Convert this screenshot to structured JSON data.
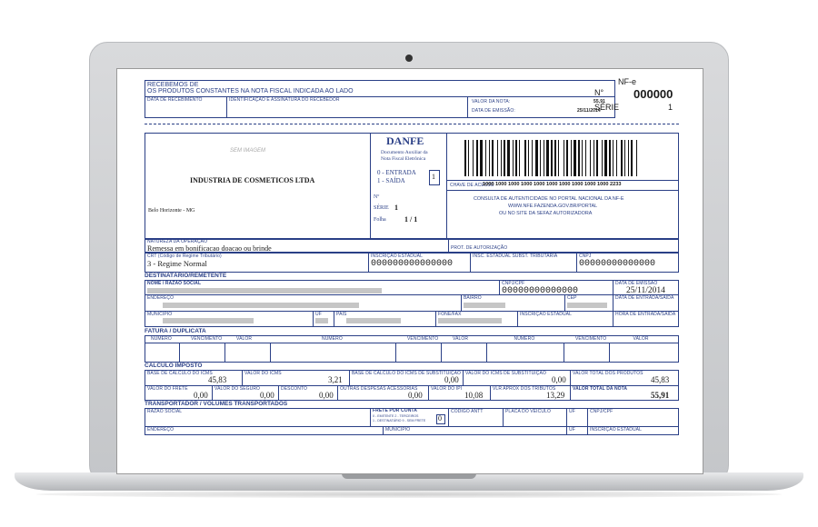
{
  "receipt": {
    "header": "RECEBEMOS DE",
    "subheader": "OS PRODUTOS CONSTANTES NA NOTA FISCAL INDICADA AO LADO",
    "data_recebimento_label": "DATA DE RECEBIMENTO",
    "identificacao_label": "IDENTIFICAÇÃO E ASSINATURA DO RECEBEDOR",
    "valor_nota_label": "VALOR DA NOTA:",
    "valor_nota": "55,91",
    "data_emissao_label": "DATA DE EMISSÃO:",
    "data_emissao": "25/11/2014",
    "nfe_label": "NF-e",
    "numero_prefix": "N°",
    "numero": "000000",
    "serie_label": "SÉRIE",
    "serie": "1"
  },
  "emitente": {
    "sem_imagem": "SEM IMAGEM",
    "nome": "INDUSTRIA DE COSMETICOS LTDA",
    "cidade": "Belo Horizonte - MG"
  },
  "danfe": {
    "title": "DANFE",
    "line1": "Documento Auxiliar da",
    "line2": "Nota Fiscal Eletrônica",
    "entrada": "0 - ENTRADA",
    "saida": "1 - SAÍDA",
    "tipo": "1",
    "numero_label": "Nº",
    "serie_label": "SÉRIE",
    "serie": "1",
    "folha_label": "Folha",
    "folha": "1 / 1"
  },
  "chave": {
    "label": "CHAVE DE ACESSO",
    "value": "1000 1000 1000 1000 1000 1000 1000 1000 1000 1000 2233",
    "consulta1": "CONSULTA DE AUTENTICIDADE NO PORTAL NACIONAL DA NF-E",
    "consulta2": "WWW.NFE.FAZENDA.GOV.BR/PORTAL",
    "consulta3": "OU NO SITE DA SEFAZ AUTORIZADORA"
  },
  "natureza": {
    "label": "NATUREZA DA OPERAÇÃO",
    "value": "Remessa em bonificacao doacao ou brinde",
    "protocolo_label": "PROT. DE AUTORIZAÇÃO",
    "crt_label": "CRT (Código de Regime Tributário)",
    "crt_value": "3 - Regime Normal",
    "ie_label": "INSCRIÇÃO ESTADUAL",
    "ie_value": "000000000000000",
    "ie_st_label": "INSC. ESTADUAL SUBST. TRIBUTARIA",
    "cnpj_label": "CNPJ",
    "cnpj_value": "00000000000000"
  },
  "destinatario": {
    "section": "DESTINATÁRIO/REMETENTE",
    "nome_label": "NOME / RAZÃO SOCIAL",
    "cnpj_label": "CNPJ/CPF",
    "cnpj_value": "00000000000000",
    "data_emissao_label": "DATA DE EMISSÃO",
    "data_emissao": "25/11/2014",
    "endereco_label": "ENDEREÇO",
    "bairro_label": "BAIRRO",
    "cep_label": "CEP",
    "data_saida_label": "DATA DE ENTRADA/SAÍDA",
    "municipio_label": "MUNICÍPIO",
    "uf_label": "UF",
    "pais_label": "PAÍS",
    "fone_label": "FONE/FAX",
    "ie_label": "INSCRIÇÃO ESTADUAL",
    "hora_label": "HORA DE ENTRADA/SAÍDA"
  },
  "fatura": {
    "section": "FATURA / DUPLICATA",
    "numero_label": "NÚMERO",
    "vencimento_label": "VENCIMENTO",
    "valor_label": "VALOR"
  },
  "imposto": {
    "section": "CALCULO IMPOSTO",
    "base_icms_label": "BASE DE CÁLCULO DO ICMS",
    "base_icms": "45,83",
    "valor_icms_label": "VALOR DO ICMS",
    "valor_icms": "3,21",
    "base_st_label": "BASE DE CÁLCULO DO ICMS DE SUBSTITUIÇÃO",
    "base_st": "0,00",
    "valor_st_label": "VALOR DO ICMS DE SUBSTITUIÇÃO",
    "valor_st": "0,00",
    "total_produtos_label": "VALOR TOTAL DOS PRODUTOS",
    "total_produtos": "45,83",
    "frete_label": "VALOR DO FRETE",
    "frete": "0,00",
    "seguro_label": "VALOR DO SEGURO",
    "seguro": "0,00",
    "desconto_label": "DESCONTO",
    "desconto": "0,00",
    "outras_label": "OUTRAS DESPESAS ACESSÓRIAS",
    "outras": "0,00",
    "ipi_label": "VALOR DO IPI",
    "ipi": "10,08",
    "tributos_label": "VLR APROX DOS TRIBUTOS",
    "tributos": "13,29",
    "total_nota_label": "VALOR TOTAL DA NOTA",
    "total_nota": "55,91"
  },
  "transportador": {
    "section": "TRANSPORTADOR / VOLUMES TRANSPORTADOS",
    "razao_label": "RAZÃO SOCIAL",
    "frete_conta_label": "FRETE POR CONTA",
    "frete_op1": "0 - EMITENTE      2 - TERCEIROS",
    "frete_op2": "1 - DESTINATÁRIO   9 - SEM FRETE",
    "frete_value": "0",
    "antt_label": "CÓDIGO ANTT",
    "placa_label": "PLACA DO VEÍCULO",
    "uf_label": "UF",
    "cnpj_label": "CNPJ/CPF",
    "endereco_label": "ENDEREÇO",
    "municipio_label": "MUNICÍPIO",
    "ie_label": "INSCRIÇÃO ESTADUAL"
  }
}
